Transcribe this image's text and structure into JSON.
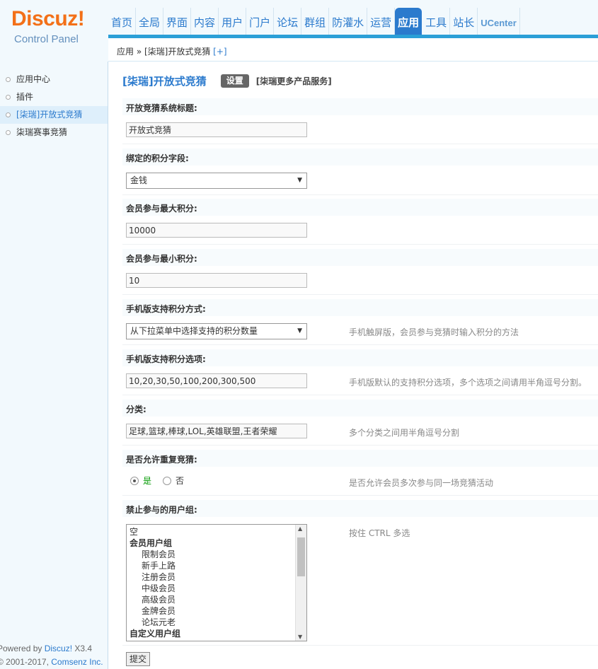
{
  "logo": {
    "brand": "Discuz!",
    "subtitle": "Control Panel"
  },
  "nav": {
    "items": [
      "首页",
      "全局",
      "界面",
      "内容",
      "用户",
      "门户",
      "论坛",
      "群组",
      "防灌水",
      "运营",
      "应用",
      "工具",
      "站长",
      "UCenter"
    ],
    "active": "应用"
  },
  "breadcrumb": {
    "text": "应用 » [柒瑞]开放式竞猜",
    "plus": "[+]"
  },
  "sidebar": {
    "items": [
      {
        "label": "应用中心"
      },
      {
        "label": "插件"
      },
      {
        "label": "[柒瑞]开放式竞猜",
        "active": true
      },
      {
        "label": "柒瑞赛事竞猜"
      }
    ],
    "footer": {
      "powered_prefix": "Powered by ",
      "powered_link": "Discuz!",
      "powered_version": " X3.4",
      "copyright_prefix": "© 2001-2017, ",
      "copyright_link": "Comsenz Inc."
    }
  },
  "main": {
    "title": "[柒瑞]开放式竞猜",
    "tab_settings": "设置",
    "more_link": "[柒瑞更多产品服务]",
    "fields": {
      "title_label": "开放竞猜系统标题:",
      "title_value": "开放式竞猜",
      "credit_label": "绑定的积分字段:",
      "credit_value": "金钱",
      "max_label": "会员参与最大积分:",
      "max_value": "10000",
      "min_label": "会员参与最小积分:",
      "min_value": "10",
      "mobile_mode_label": "手机版支持积分方式:",
      "mobile_mode_value": "从下拉菜单中选择支持的积分数量",
      "mobile_mode_hint": "手机触屏版，会员参与竞猜时输入积分的方法",
      "mobile_options_label": "手机版支持积分选项:",
      "mobile_options_value": "10,20,30,50,100,200,300,500",
      "mobile_options_hint": "手机版默认的支持积分选项，多个选项之间请用半角逗号分割。",
      "category_label": "分类:",
      "category_value": "足球,篮球,棒球,LOL,英雄联盟,王者荣耀",
      "category_hint": "多个分类之间用半角逗号分割",
      "repeat_label": "是否允许重复竞猜:",
      "repeat_yes": "是",
      "repeat_no": "否",
      "repeat_selected": "是",
      "repeat_hint": "是否允许会员多次参与同一场竞猜活动",
      "forbid_label": "禁止参与的用户组:",
      "forbid_hint": "按住 CTRL 多选",
      "forbid_options": [
        {
          "label": "空",
          "kind": "plain"
        },
        {
          "label": "会员用户组",
          "kind": "group"
        },
        {
          "label": "限制会员",
          "kind": "sub"
        },
        {
          "label": "新手上路",
          "kind": "sub"
        },
        {
          "label": "注册会员",
          "kind": "sub"
        },
        {
          "label": "中级会员",
          "kind": "sub"
        },
        {
          "label": "高级会员",
          "kind": "sub"
        },
        {
          "label": "金牌会员",
          "kind": "sub"
        },
        {
          "label": "论坛元老",
          "kind": "sub"
        },
        {
          "label": "自定义用户组",
          "kind": "group"
        }
      ]
    },
    "submit_label": "提交"
  },
  "colors": {
    "accent": "#2b7acd",
    "logo_orange": "#f37018",
    "nav_bar": "#2b9fd7",
    "sidebar_bg": "#f2f9fd"
  }
}
